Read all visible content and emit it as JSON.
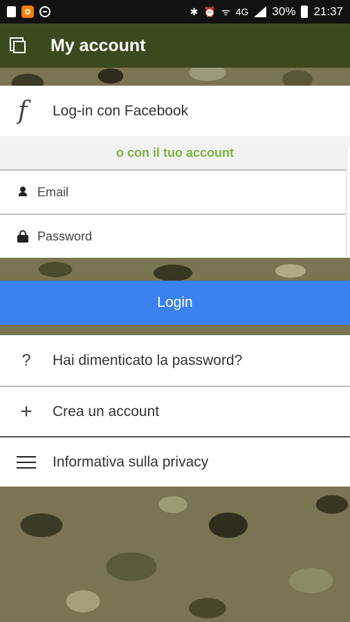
{
  "status_bar": {
    "network": "4G",
    "battery": "30%",
    "time": "21:37"
  },
  "app_bar": {
    "title": "My account"
  },
  "facebook": {
    "label": "Log-in con Facebook",
    "icon": "facebook-f-icon"
  },
  "divider_text": "o con il tuo account",
  "form": {
    "email_placeholder": "Email",
    "password_placeholder": "Password"
  },
  "login_button": "Login",
  "menu": [
    {
      "icon": "question-mark-icon",
      "label": "Hai dimenticato la password?"
    },
    {
      "icon": "plus-icon",
      "label": "Crea un account"
    },
    {
      "icon": "hamburger-menu-icon",
      "label": "Informativa sulla privacy"
    }
  ],
  "colors": {
    "app_bar": "#3b4a1e",
    "accent_green": "#7cb342",
    "login_blue": "#3b82f0"
  }
}
